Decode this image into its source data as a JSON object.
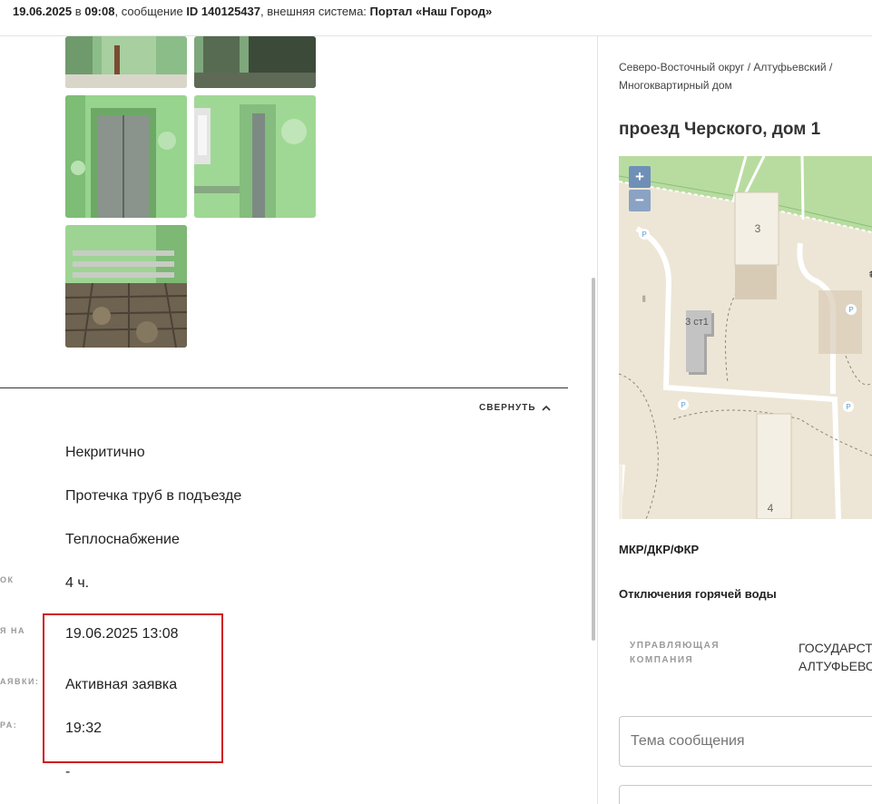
{
  "header": {
    "date": "19.06.2025",
    "in_word": " в ",
    "time": "09:08",
    "message_word": ", сообщение ",
    "id_text": "ID 140125437",
    "system_word": ", внешняя система: ",
    "system_name": "Портал «Наш Город»"
  },
  "details": {
    "collapse_label": "СВЕРНУТЬ",
    "rows": [
      {
        "label": "",
        "value": "Некритично"
      },
      {
        "label": "",
        "value": "Протечка труб в подъезде"
      },
      {
        "label": "",
        "value": "Теплоснабжение"
      },
      {
        "label": "ОК",
        "value": "4 ч."
      },
      {
        "label": "Я НА",
        "value": "19.06.2025 13:08"
      },
      {
        "label": "АЯВКИ:",
        "value": "Активная заявка"
      },
      {
        "label": "РА:",
        "value": "19:32"
      },
      {
        "label": "",
        "value": "-"
      }
    ]
  },
  "right_panel": {
    "breadcrumb": "Северо-Восточный округ / Алтуфьевский / Многоквартирный дом",
    "address": "проезд Черского, дом 1",
    "map": {
      "zoom_in": "+",
      "zoom_out": "−",
      "building_labels": [
        "3",
        "3 ст1",
        "4"
      ],
      "parking_label": "P"
    },
    "program": "МКР/ДКР/ФКР",
    "outage": "Отключения горячей воды",
    "management_label_line1": "УПРАВЛЯЮЩАЯ",
    "management_label_line2": "КОМПАНИЯ",
    "management_value_line1": "ГОСУДАРСТВ",
    "management_value_line2": "АЛТУФЬЕВСК",
    "subject_placeholder": "Тема сообщения"
  },
  "colors": {
    "highlight": "#d0151b",
    "map_base": "#ede6d6",
    "map_green": "#b8dca0",
    "zoom": "#6f8fb7"
  }
}
